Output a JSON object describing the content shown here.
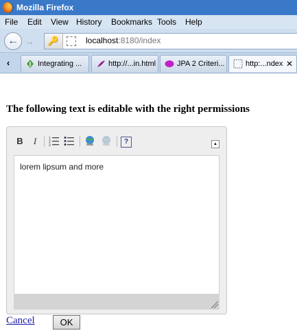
{
  "window": {
    "title": "Mozilla Firefox"
  },
  "menu": {
    "items": [
      "File",
      "Edit",
      "View",
      "History",
      "Bookmarks",
      "Tools",
      "Help"
    ]
  },
  "nav": {
    "url_host": "localhost",
    "url_rest": ":8180/index"
  },
  "tabs": [
    {
      "label": "Integrating ...",
      "icon": "green-leaf-icon"
    },
    {
      "label": "http://...in.html",
      "icon": "quill-icon"
    },
    {
      "label": "JPA 2 Criteri...",
      "icon": "purple-blob-icon"
    },
    {
      "label": "http:...ndex",
      "icon": "blank-page-icon",
      "close": "✕"
    }
  ],
  "page": {
    "heading": "The following text is editable with the right permissions",
    "editor_content": "lorem lipsum and more",
    "cancel_label": "Cancel",
    "ok_label": "OK"
  },
  "editor_toolbar": {
    "bold": "B",
    "italic": "I",
    "help": "?"
  },
  "colors": {
    "titlebar": "#3a78c8",
    "link": "#1a1aa6"
  }
}
